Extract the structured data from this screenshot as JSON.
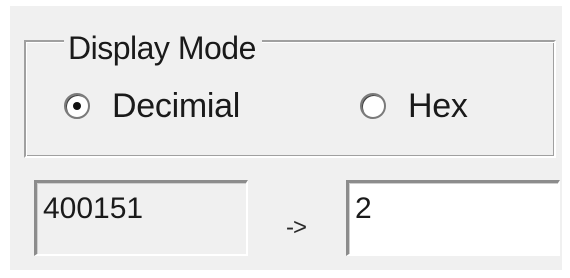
{
  "display_mode": {
    "legend": "Display Mode",
    "options": [
      {
        "label": "Decimial",
        "selected": true
      },
      {
        "label": "Hex",
        "selected": false
      }
    ]
  },
  "conversion": {
    "input_value": "400151",
    "arrow": "->",
    "output_value": "2"
  }
}
